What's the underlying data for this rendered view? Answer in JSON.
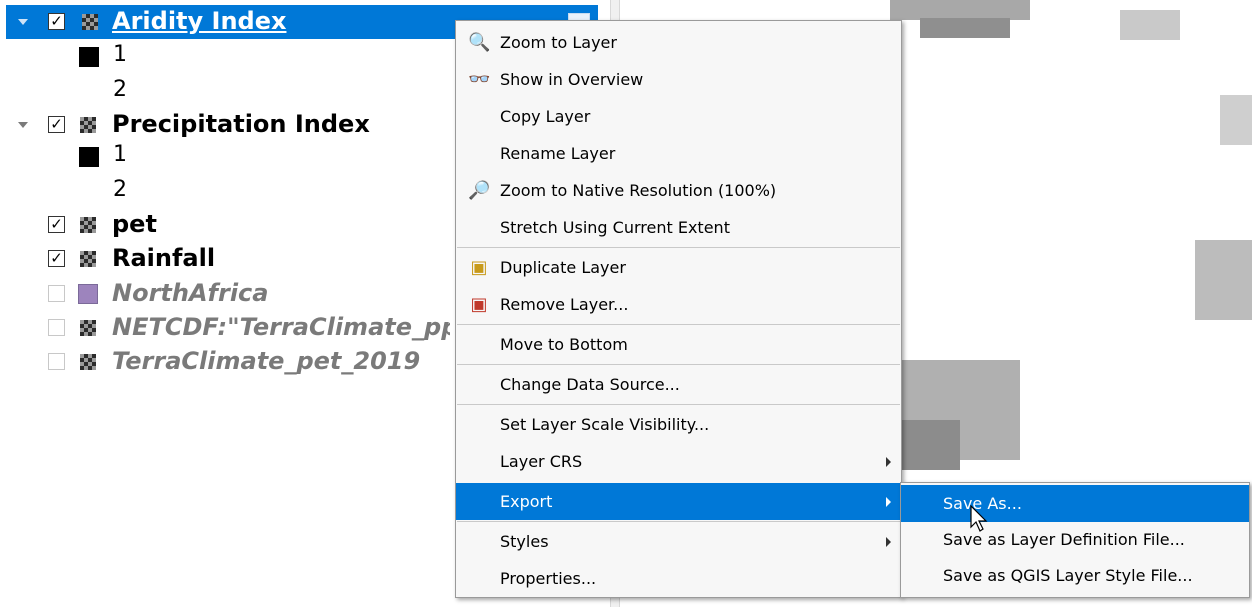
{
  "layers": {
    "items": [
      {
        "name": "Aridity Index",
        "checked": true,
        "selected": true,
        "legend": [
          "1",
          "2"
        ]
      },
      {
        "name": "Precipitation Index",
        "checked": true,
        "selected": false,
        "legend": [
          "1",
          "2"
        ]
      },
      {
        "name": "pet",
        "checked": true
      },
      {
        "name": "Rainfall",
        "checked": true
      },
      {
        "name": "NorthAfrica",
        "checked": false
      },
      {
        "name": "NETCDF:\"TerraClimate_pp",
        "checked": false
      },
      {
        "name": "TerraClimate_pet_2019",
        "checked": false
      }
    ]
  },
  "context_menu": {
    "items": [
      {
        "label": "Zoom to Layer",
        "icon": "zoom-layer-icon"
      },
      {
        "label": "Show in Overview",
        "icon": "overview-icon"
      },
      {
        "label": "Copy Layer"
      },
      {
        "label": "Rename Layer"
      },
      {
        "label": "Zoom to Native Resolution (100%)",
        "icon": "native-resolution-icon"
      },
      {
        "label": "Stretch Using Current Extent"
      },
      {
        "label": "Duplicate Layer",
        "icon": "duplicate-layer-icon"
      },
      {
        "label": "Remove Layer...",
        "icon": "remove-layer-icon"
      },
      {
        "label": "Move to Bottom"
      },
      {
        "label": "Change Data Source..."
      },
      {
        "label": "Set Layer Scale Visibility..."
      },
      {
        "label": "Layer CRS",
        "submenu": true
      },
      {
        "label": "Export",
        "submenu": true,
        "highlighted": true
      },
      {
        "label": "Styles",
        "submenu": true
      },
      {
        "label": "Properties..."
      }
    ]
  },
  "export_submenu": {
    "items": [
      {
        "label": "Save As...",
        "highlighted": true
      },
      {
        "label": "Save as Layer Definition File..."
      },
      {
        "label": "Save as QGIS Layer Style File..."
      }
    ]
  },
  "colors": {
    "highlight": "#0078d7",
    "polygon_fill": "#9d84bd"
  }
}
